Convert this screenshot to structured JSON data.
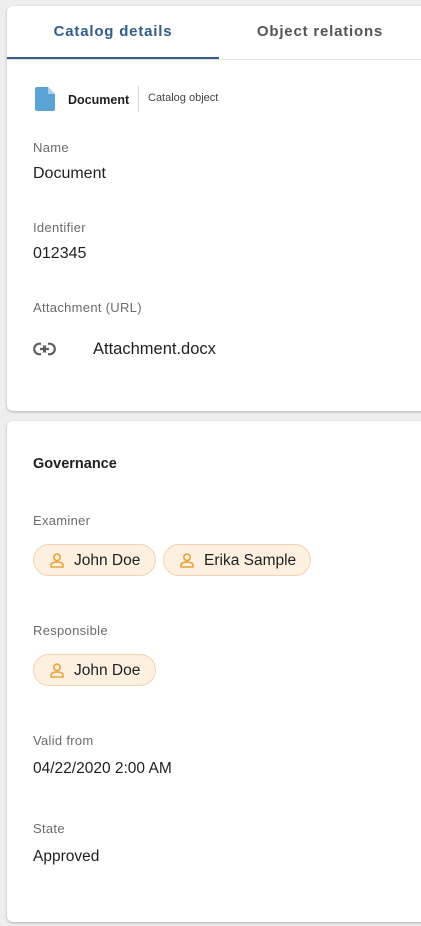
{
  "tabs": [
    {
      "label": "Catalog details",
      "active": true
    },
    {
      "label": "Object relations",
      "active": false
    }
  ],
  "object": {
    "icon": "document-icon",
    "name": "Document",
    "type": "Catalog object"
  },
  "details": {
    "name_label": "Name",
    "name_value": "Document",
    "identifier_label": "Identifier",
    "identifier_value": "012345",
    "attachment_label": "Attachment (URL)",
    "attachment_icon": "link-icon",
    "attachment_value": "Attachment.docx"
  },
  "governance": {
    "title": "Governance",
    "examiner_label": "Examiner",
    "examiners": [
      "John Doe",
      "Erika Sample"
    ],
    "responsible_label": "Responsible",
    "responsible": [
      "John Doe"
    ],
    "valid_from_label": "Valid from",
    "valid_from_value": "04/22/2020 2:00 AM",
    "state_label": "State",
    "state_value": "Approved"
  },
  "colors": {
    "accent": "#2f5d8c",
    "chip_bg": "#fdf0e1",
    "chip_border": "#f1d3ad",
    "chip_icon": "#e8a23a",
    "doc_icon": "#5aa3d6"
  }
}
